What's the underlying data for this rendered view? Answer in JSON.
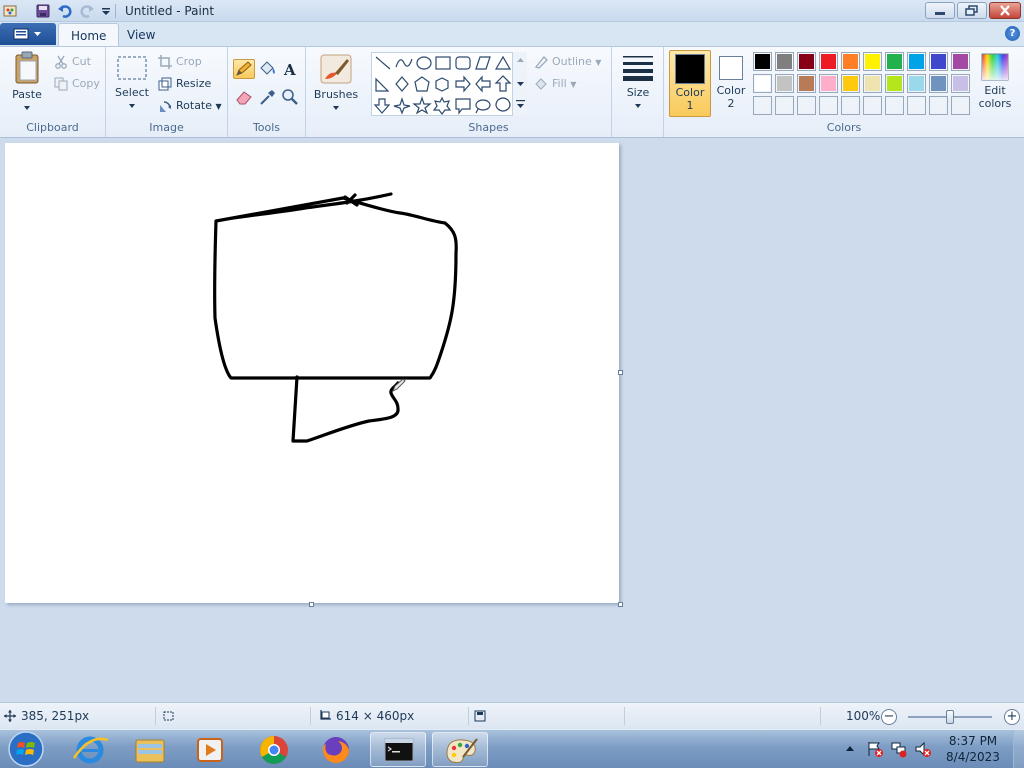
{
  "window": {
    "title": "Untitled - Paint"
  },
  "tabs": [
    {
      "label": "Home",
      "active": true
    },
    {
      "label": "View",
      "active": false
    }
  ],
  "ribbon": {
    "clipboard": {
      "label": "Clipboard",
      "paste": "Paste",
      "cut": "Cut",
      "copy": "Copy"
    },
    "image": {
      "label": "Image",
      "select": "Select",
      "crop": "Crop",
      "resize": "Resize",
      "rotate": "Rotate"
    },
    "tools": {
      "label": "Tools"
    },
    "brushes": {
      "label": "Brushes"
    },
    "shapes": {
      "label": "Shapes",
      "outline": "Outline",
      "fill": "Fill"
    },
    "size": {
      "label": "Size"
    },
    "colors": {
      "label": "Colors",
      "color1_line1": "Color",
      "color1_line2": "1",
      "color2_line1": "Color",
      "color2_line2": "2",
      "edit_line1": "Edit",
      "edit_line2": "colors",
      "color1_value": "#000000",
      "color2_value": "#ffffff",
      "palette_row1": [
        "#000000",
        "#7f7f7f",
        "#880015",
        "#ed1c24",
        "#ff7f27",
        "#fff200",
        "#22b14c",
        "#00a2e8",
        "#3f48cc",
        "#a349a4"
      ],
      "palette_row2": [
        "#ffffff",
        "#c3c3c3",
        "#b97a57",
        "#ffaec9",
        "#ffc90e",
        "#efe4b0",
        "#b5e61d",
        "#99d9ea",
        "#7092be",
        "#c8bfe7"
      ]
    }
  },
  "status": {
    "cursor_position": "385, 251px",
    "canvas_size": "614 × 460px",
    "zoom": "100%",
    "zoom_level": 100
  },
  "taskbar": {
    "time": "8:37 PM",
    "date": "8/4/2023"
  }
}
